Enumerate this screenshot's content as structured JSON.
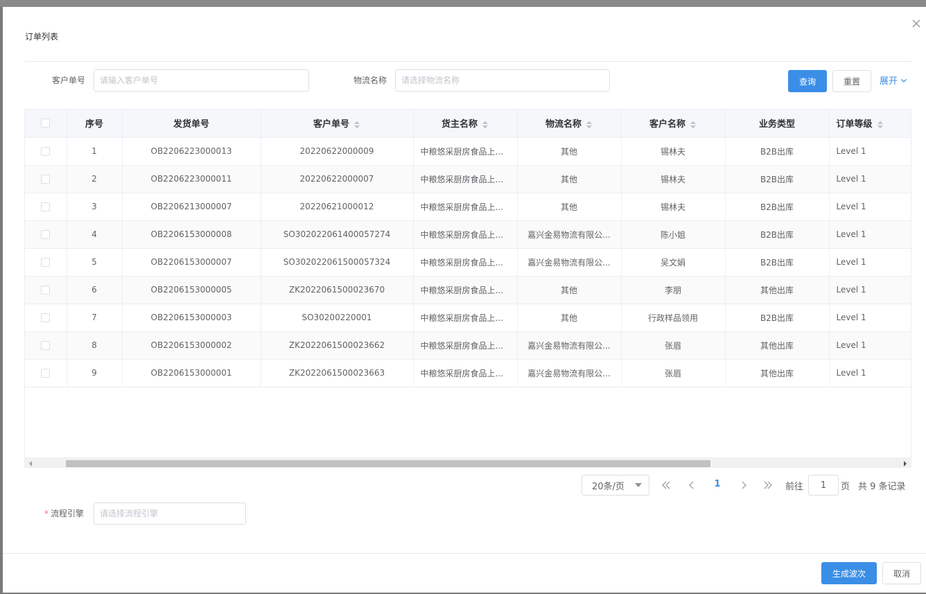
{
  "modal": {
    "title": "订单列表"
  },
  "search": {
    "customer_no_label": "客户单号",
    "customer_no_placeholder": "请输入客户单号",
    "logistics_label": "物流名称",
    "logistics_placeholder": "请选择物流名称",
    "query_label": "查询",
    "reset_label": "重置",
    "expand_label": "展开"
  },
  "table": {
    "headers": [
      "序号",
      "发货单号",
      "客户单号",
      "货主名称",
      "物流名称",
      "客户名称",
      "业务类型",
      "订单等级"
    ],
    "rows": [
      [
        "1",
        "OB2206223000013",
        "20220622000009",
        "中粮悠采厨房食品上...",
        "其他",
        "锡林夫",
        "B2B出库",
        "Level 1"
      ],
      [
        "2",
        "OB2206223000011",
        "20220622000007",
        "中粮悠采厨房食品上...",
        "其他",
        "锡林夫",
        "B2B出库",
        "Level 1"
      ],
      [
        "3",
        "OB2206213000007",
        "20220621000012",
        "中粮悠采厨房食品上...",
        "其他",
        "锡林夫",
        "B2B出库",
        "Level 1"
      ],
      [
        "4",
        "OB2206153000008",
        "SO302022061400057274",
        "中粮悠采厨房食品上...",
        "嘉兴金易物流有限公...",
        "陈小姐",
        "B2B出库",
        "Level 1"
      ],
      [
        "5",
        "OB2206153000007",
        "SO302022061500057324",
        "中粮悠采厨房食品上...",
        "嘉兴金易物流有限公...",
        "吴文娟",
        "B2B出库",
        "Level 1"
      ],
      [
        "6",
        "OB2206153000005",
        "ZK2022061500023670",
        "中粮悠采厨房食品上...",
        "其他",
        "李朋",
        "其他出库",
        "Level 1"
      ],
      [
        "7",
        "OB2206153000003",
        "SO30200220001",
        "中粮悠采厨房食品上...",
        "其他",
        "行政样品领用",
        "B2B出库",
        "Level 1"
      ],
      [
        "8",
        "OB2206153000002",
        "ZK2022061500023662",
        "中粮悠采厨房食品上...",
        "嘉兴金易物流有限公...",
        "张眉",
        "其他出库",
        "Level 1"
      ],
      [
        "9",
        "OB2206153000001",
        "ZK2022061500023663",
        "中粮悠采厨房食品上...",
        "嘉兴金易物流有限公...",
        "张眉",
        "其他出库",
        "Level 1"
      ]
    ]
  },
  "pagination": {
    "page_size": "20条/页",
    "current_page": "1",
    "goto_prefix": "前往",
    "goto_value": "1",
    "goto_suffix": "页",
    "total_text": "共 9 条记录"
  },
  "process": {
    "required_mark": "*",
    "label": "流程引擎",
    "placeholder": "请选择流程引擎"
  },
  "footer": {
    "generate_label": "生成波次",
    "cancel_label": "取消"
  },
  "colors": {
    "primary": "#3a8ee6",
    "required": "#f56c6c"
  }
}
